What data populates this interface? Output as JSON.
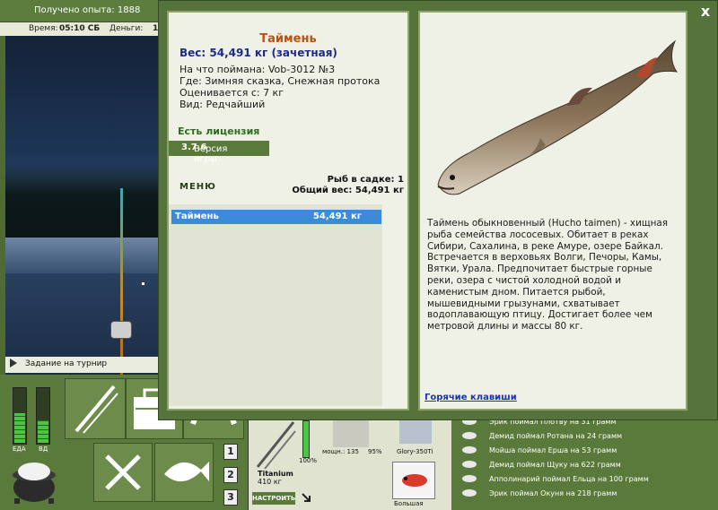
{
  "topbar": {
    "experience": "Получено опыта: 1888",
    "time_label": "Время:",
    "time_value": "05:10 СБ",
    "money_label": "Деньги:",
    "money_value": "1"
  },
  "scene": {
    "tournament_task": "Задание на турнир"
  },
  "meters": {
    "food_label": "ЕДА",
    "water_label": "ВД",
    "food_level": 0.55,
    "water_level": 0.42
  },
  "slots": [
    "1",
    "2",
    "3"
  ],
  "tackle": {
    "rod_name": "Titanium",
    "rod_weight": "410 кг",
    "rod_percent": "100%",
    "setup_button": "НАСТРОИТЬ",
    "reel_power_label": "мощн.: 135",
    "reel_percent": "95%",
    "line_name": "Glory-350Ti",
    "lure_size": "Большая"
  },
  "dialog": {
    "close": "x",
    "fish_name": "Таймень",
    "weight_line": "Вес: 54,491 кг (зачетная)",
    "caught_on": "На что поймана: Vob-3012 №3",
    "location": "Где: Зимняя сказка, Снежная протока",
    "rated_from": "Оценивается с: 7 кг",
    "species_type": "Вид: Редчайший",
    "license": "Есть лицензия",
    "version_label": "Версия игры:",
    "version_value": "3.7.6",
    "menu_button": "МЕНЮ",
    "cage_count": "Рыб в садке: 1",
    "total_weight": "Общий вес: 54,491 кг",
    "catch_list": [
      {
        "name": "Таймень",
        "weight": "54,491 кг"
      }
    ],
    "description": "Таймень обыкновенный (Hucho taimen) - хищная рыба семейства лососевых. Обитает в реках Сибири, Сахалина, в реке Амуре, озере Байкал. Встречается в верховьях Волги, Печоры, Камы, Вятки, Урала. Предпочитает быстрые горные реки, озера с чистой холодной водой и каменистым дном. Питается рыбой, мышевидными грызунами, схватывает водоплавающую птицу. Достигает более чем метровой длины и массы 80 кг.",
    "hotkeys_link": "Горячие клавиши"
  },
  "feed": [
    "Эрик поймал Плотву на 31 грамм",
    "Демид поймал Ротана на 24 грамм",
    "Мойша поймал Ерша на 53 грамм",
    "Демид поймал Щуку на 622 грамм",
    "Апполинарий поймал Ельца на 100 грамм",
    "Эрик поймал Окуня на 218 грамм"
  ],
  "colors": {
    "panel_green": "#55733a",
    "fish_name": "#b55314",
    "weight_blue": "#1b2b86",
    "list_highlight": "#3b8bd8",
    "license_green": "#2c6d1f"
  }
}
